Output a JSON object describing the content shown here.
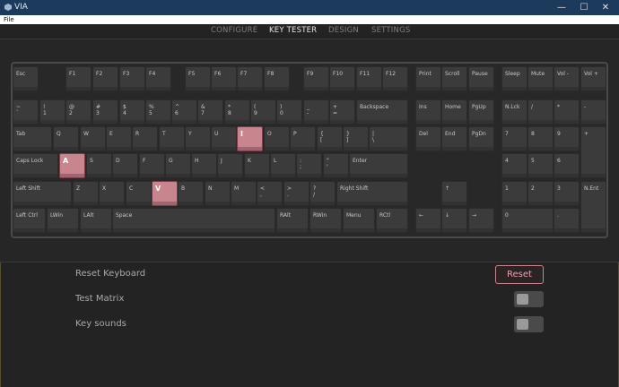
{
  "window": {
    "title": "VIA",
    "min": "—",
    "max": "☐",
    "close": "✕"
  },
  "menu": {
    "file": "File"
  },
  "tabs": [
    {
      "label": "CONFIGURE"
    },
    {
      "label": "KEY TESTER"
    },
    {
      "label": "DESIGN"
    },
    {
      "label": "SETTINGS"
    }
  ],
  "active_tab": "KEY TESTER",
  "keys": {
    "esc": "Esc",
    "f1": "F1",
    "f2": "F2",
    "f3": "F3",
    "f4": "F4",
    "f5": "F5",
    "f6": "F6",
    "f7": "F7",
    "f8": "F8",
    "f9": "F9",
    "f10": "F10",
    "f11": "F11",
    "f12": "F12",
    "print": "Print",
    "scroll": "Scroll",
    "pause": "Pause",
    "sleep": "Sleep",
    "mute": "Mute",
    "vol_down": "Vol -",
    "vol_up": "Vol +",
    "grave": "~\n`",
    "n1": "!\n1",
    "n2": "@\n2",
    "n3": "#\n3",
    "n4": "$\n4",
    "n5": "%\n5",
    "n6": "^\n6",
    "n7": "&\n7",
    "n8": "*\n8",
    "n9": "(\n9",
    "n0": ")\n0",
    "minus": "_\n-",
    "equal": "+\n=",
    "backspace": "Backspace",
    "ins": "Ins",
    "home": "Home",
    "pgup": "PgUp",
    "nlck": "N.Lck",
    "kp_slash": "/",
    "kp_star": "*",
    "kp_minus": "-",
    "tab": "Tab",
    "q": "Q",
    "w": "W",
    "e": "E",
    "r": "R",
    "t": "T",
    "y": "Y",
    "u": "U",
    "i": "I",
    "o": "O",
    "p": "P",
    "lbracket": "{\n[",
    "rbracket": "}\n]",
    "backslash": "|\n\\",
    "del": "Del",
    "end": "End",
    "pgdn": "PgDn",
    "kp7": "7",
    "kp8": "8",
    "kp9": "9",
    "kp_plus": "+",
    "caps": "Caps Lock",
    "a": "A",
    "s": "S",
    "d": "D",
    "f": "F",
    "g": "G",
    "h": "H",
    "j": "J",
    "k": "K",
    "l": "L",
    "semicolon": ":\n;",
    "quote": "\"\n'",
    "enter": "Enter",
    "kp4": "4",
    "kp5": "5",
    "kp6": "6",
    "lshift": "Left Shift",
    "z": "Z",
    "x": "X",
    "c": "C",
    "v": "V",
    "b": "B",
    "n": "N",
    "m": "M",
    "comma": "<\n,",
    "period": ">\n.",
    "slash": "?\n/",
    "rshift": "Right Shift",
    "up": "↑",
    "kp1": "1",
    "kp2": "2",
    "kp3": "3",
    "kp_enter": "N.Ent",
    "lctrl": "Left Ctrl",
    "lwin": "LWin",
    "lalt": "LAlt",
    "space": "Space",
    "ralt": "RAlt",
    "rwin": "RWin",
    "menu": "Menu",
    "rctrl": "RCtl",
    "left": "←",
    "down": "↓",
    "right": "→",
    "kp0": "0",
    "kp_dot": "."
  },
  "pressed_keys": [
    "i",
    "a",
    "v"
  ],
  "settings": {
    "reset_keyboard_label": "Reset Keyboard",
    "reset_button": "Reset",
    "test_matrix_label": "Test Matrix",
    "test_matrix_on": false,
    "key_sounds_label": "Key sounds",
    "key_sounds_on": false
  },
  "colors": {
    "accent_pressed": "#c9858e",
    "titlebar": "#1b3a5c",
    "reset_border": "#c9858e"
  }
}
